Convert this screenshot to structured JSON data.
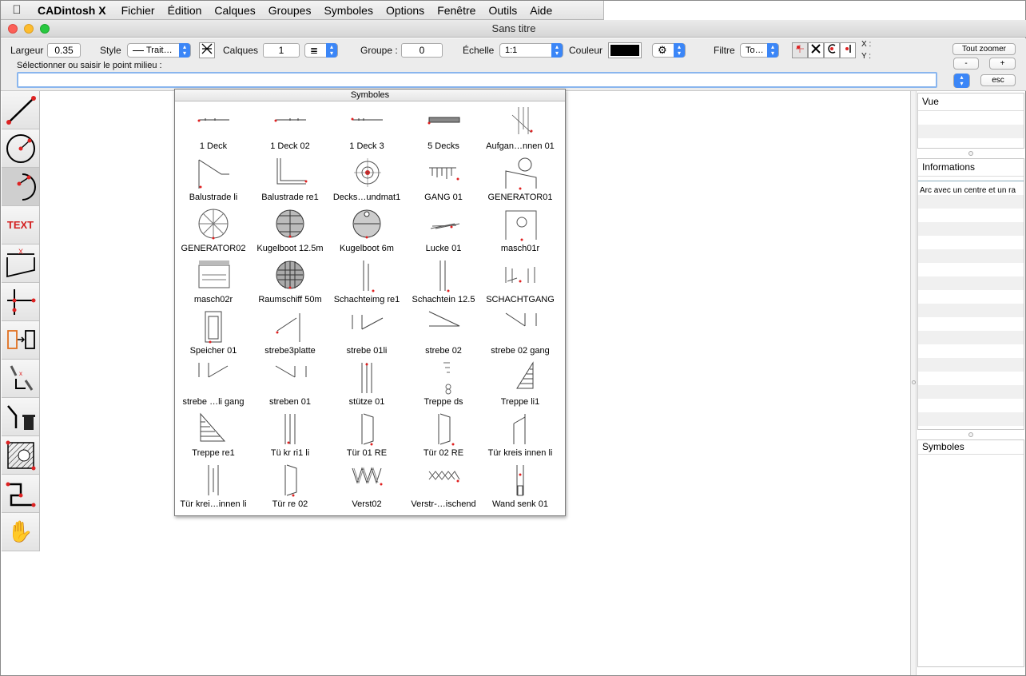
{
  "menubar": {
    "app_name": "CADintosh X",
    "items": [
      "Fichier",
      "Édition",
      "Calques",
      "Groupes",
      "Symboles",
      "Options",
      "Fenêtre",
      "Outils",
      "Aide"
    ]
  },
  "window": {
    "title": "Sans titre"
  },
  "toolbar": {
    "largeur_label": "Largeur",
    "largeur_value": "0.35",
    "style_label": "Style",
    "style_value": "Trait…",
    "calques_label": "Calques",
    "calques_value": "1",
    "groupe_label": "Groupe :",
    "groupe_value": "0",
    "echelle_label": "Échelle",
    "echelle_value": "1:1",
    "couleur_label": "Couleur",
    "couleur_value": "#000000",
    "filtre_label": "Filtre",
    "filtre_value": "To…",
    "x_label": "X :",
    "y_label": "Y :",
    "zoom_all": "Tout zoomer",
    "zoom_minus": "-",
    "zoom_plus": "+",
    "esc": "esc",
    "prompt": "Sélectionner ou saisir le point milieu :",
    "command_value": ""
  },
  "tools": [
    "line-tool",
    "circle-tool",
    "arc-tool",
    "text-tool",
    "dimension-tool",
    "intersection-tool",
    "copy-tool",
    "edit-tool",
    "delete-tool",
    "hatch-tool",
    "polyline-tool",
    "pan-tool"
  ],
  "tools_text_label": "TEXT",
  "palette": {
    "title": "Symboles",
    "symbols": [
      "1 Deck",
      "1 Deck 02",
      "1 Deck 3",
      "5 Decks",
      "Aufgan…nnen 01",
      "Balustrade li",
      "Balustrade re1",
      "Decks…undmat1",
      "GANG 01",
      "GENERATOR01",
      "GENERATOR02",
      "Kugelboot 12.5m",
      "Kugelboot 6m",
      "Lucke 01",
      "masch01r",
      "masch02r",
      "Raumschiff 50m",
      "Schachteimg re1",
      "Schachtein 12.5",
      "SCHACHTGANG",
      "Speicher 01",
      "strebe3platte",
      "strebe 01li",
      "strebe 02",
      "strebe 02 gang",
      "strebe …li gang",
      "streben 01",
      "stütze 01",
      "Treppe ds",
      "Treppe li1",
      "Treppe re1",
      "Tü kr ri1 li",
      "Tür 01 RE",
      "Tür 02 RE",
      "Tür kreis innen li",
      "Tür krei…innen li",
      "Tür re 02",
      "Verst02",
      "Verstr-…ischend",
      "Wand senk 01"
    ]
  },
  "right_panel": {
    "vue_title": "Vue",
    "info_title": "Informations",
    "info_text": "Arc avec un centre et un ra",
    "symboles_title": "Symboles"
  },
  "colors": {
    "accent": "#3b86f7",
    "marker": "#e02020"
  }
}
